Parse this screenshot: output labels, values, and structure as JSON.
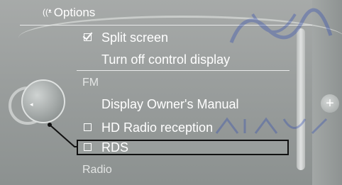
{
  "menu": {
    "title": "Options",
    "items": [
      {
        "label": "Split screen",
        "checkbox": "checked"
      },
      {
        "label": "Turn off control display",
        "checkbox": "none"
      }
    ],
    "section_fm": "FM",
    "fm_items": [
      {
        "label": "Display Owner's Manual",
        "checkbox": "none"
      },
      {
        "label": "HD Radio reception",
        "checkbox": "unchecked"
      },
      {
        "label": "RDS",
        "checkbox": "unchecked",
        "highlighted": true
      }
    ],
    "section_radio": "Radio"
  },
  "controller": {
    "plus_glyph": "+",
    "left_arrow_glyph": "◂"
  },
  "colors": {
    "background": "#9b9f9e",
    "text": "#ffffff",
    "highlight_border": "#111111"
  },
  "icons": {
    "header": "antenna-signal-icon",
    "plus": "plus-icon",
    "knob": "idrive-controller-knob-icon"
  }
}
